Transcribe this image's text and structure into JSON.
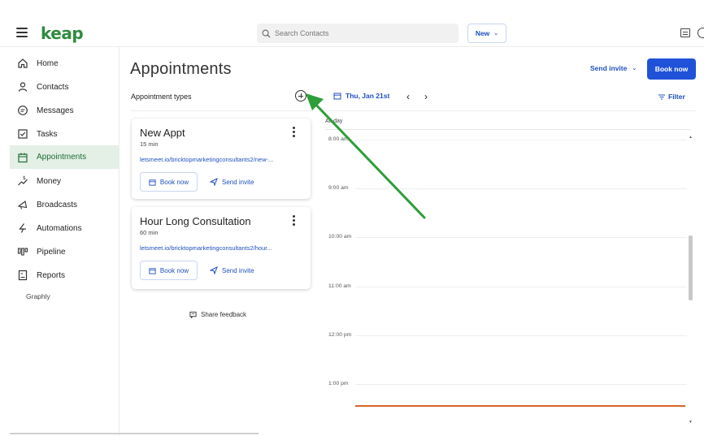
{
  "app": {
    "logo": "keap",
    "menu_icon": "hamburger-icon",
    "search_placeholder": "Search Contacts",
    "new_label": "New"
  },
  "sidebar": {
    "items": [
      {
        "label": "Home",
        "icon": "home-icon"
      },
      {
        "label": "Contacts",
        "icon": "person-icon"
      },
      {
        "label": "Messages",
        "icon": "chat-icon"
      },
      {
        "label": "Tasks",
        "icon": "checkbox-icon"
      },
      {
        "label": "Appointments",
        "icon": "calendar-icon",
        "active": true
      },
      {
        "label": "Money",
        "icon": "money-icon"
      },
      {
        "label": "Broadcasts",
        "icon": "megaphone-icon"
      },
      {
        "label": "Automations",
        "icon": "lightning-icon"
      },
      {
        "label": "Pipeline",
        "icon": "pipeline-icon"
      },
      {
        "label": "Reports",
        "icon": "report-icon"
      }
    ],
    "extra_label": "Graphly"
  },
  "page": {
    "title": "Appointments",
    "send_invite_label": "Send invite",
    "book_now_label": "Book now"
  },
  "appointment_types": {
    "header": "Appointment types",
    "cards": [
      {
        "name": "New Appt",
        "duration": "15 min",
        "link": "letsmeet.io/bricktopmarketingconsultants2/new-...",
        "book_label": "Book now",
        "send_label": "Send invite"
      },
      {
        "name": "Hour Long Consultation",
        "duration": "60 min",
        "link": "letsmeet.io/bricktopmarketingconsultants2/hour...",
        "book_label": "Book now",
        "send_label": "Send invite"
      }
    ],
    "feedback_label": "Share feedback"
  },
  "calendar": {
    "date_label": "Thu, Jan 21st",
    "prev_symbol": "‹",
    "next_symbol": "›",
    "filter_label": "Filter",
    "all_day_label": "All-day",
    "times": [
      "8:00 am",
      "9:00 am",
      "10:00 am",
      "11:00 am",
      "12:00 pm",
      "1:00 pm"
    ]
  },
  "colors": {
    "brand_green": "#2e8b3e",
    "accent_blue": "#1f52d8",
    "active_bg": "#e4efe6",
    "now_line": "#d8642a",
    "annotation_arrow": "#2e9e3a"
  }
}
